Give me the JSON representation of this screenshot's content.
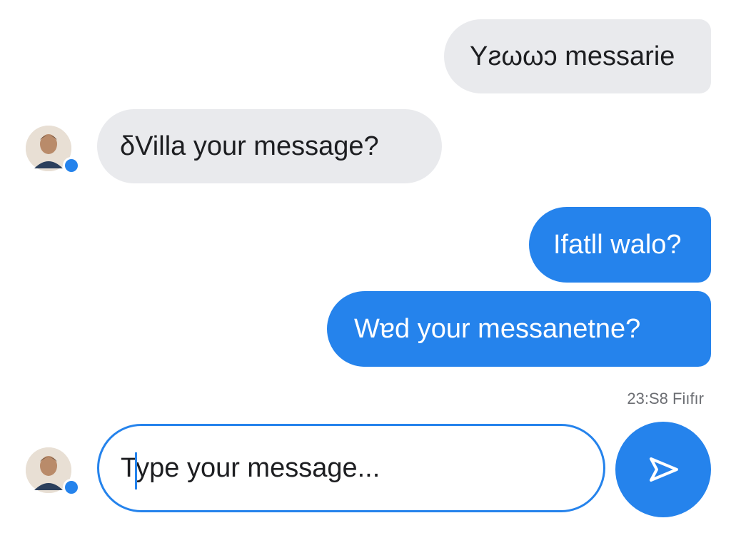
{
  "messages": [
    {
      "text": "Yƨωωɔ messarie",
      "direction": "outgoing",
      "style": "gray"
    },
    {
      "text": "δVilla your message?",
      "direction": "incoming",
      "style": "gray"
    },
    {
      "text": "Ifatll walo?",
      "direction": "outgoing",
      "style": "blue"
    },
    {
      "text": "Wɐd your messanetne?",
      "direction": "outgoing",
      "style": "blue"
    }
  ],
  "timestamp": "23:S8 Fiıfır",
  "composer": {
    "placeholder": "Type your message...",
    "value": ""
  },
  "send_icon": "send-arrow-icon",
  "colors": {
    "accent": "#2583ec",
    "incoming_bubble": "#e9eaed",
    "text": "#1d1e21",
    "timestamp": "#6c6e73"
  }
}
